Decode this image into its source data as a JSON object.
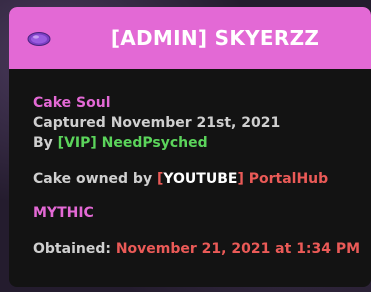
{
  "header": {
    "title": "[ADMIN] SKYERZZ",
    "icon": "purple-gem-icon",
    "background_color": "#e369d5"
  },
  "item": {
    "name": "Cake Soul",
    "captured": "Captured November 21st, 2021",
    "by_prefix": "By ",
    "by_rank": "[VIP]",
    "by_name": "NeedPsyched",
    "owned_prefix": "Cake owned by ",
    "owner_rank_open": "[",
    "owner_rank": "YOUTUBE",
    "owner_rank_close": "]",
    "owner_name": "PortalHub",
    "rarity": "MYTHIC",
    "obtained_label": "Obtained:",
    "obtained_value": "November 21, 2021 at 1:34 PM"
  },
  "colors": {
    "pink": "#e369d5",
    "green": "#5bd45b",
    "red": "#ea5a57",
    "text": "#cfcfcf"
  }
}
